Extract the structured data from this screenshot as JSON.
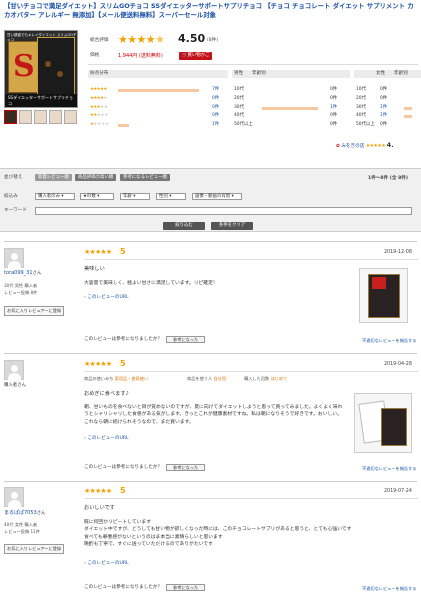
{
  "product": {
    "title": "【甘いチョコで満足ダイエット】スリムGOチョコ SSダイエッターサポートサプリチョコ 【チョコ チョコレート ダイエット サプリメント カカオバター アレルギー 無添加】【メール便送料無料】スーパーセール対象",
    "image_top_caption": "甘い誘惑でもキレイダイエット スリムGOチョコ",
    "image_caption": "SSダイエッターサポートサプリチョコ",
    "image_mark": "S"
  },
  "summary": {
    "rating_label": "総合評価",
    "rating_value": "4.50",
    "rating_count": "(8件)",
    "price_label": "価格",
    "price": "1,944円 (送料無料)",
    "cart_label": "買い物かご",
    "score_dist_label": "採点分布",
    "score_dist": [
      {
        "stars": 5,
        "count": "7件",
        "fraction": 0.88
      },
      {
        "stars": 4,
        "count": "0件",
        "fraction": 0
      },
      {
        "stars": 3,
        "count": "0件",
        "fraction": 0
      },
      {
        "stars": 2,
        "count": "0件",
        "fraction": 0
      },
      {
        "stars": 1,
        "count": "1件",
        "fraction": 0.12
      }
    ],
    "male_label": "男性",
    "female_label": "女性",
    "age_label": "年齢別",
    "male_ages": [
      {
        "age": "10代",
        "count": "0件",
        "fraction": 0
      },
      {
        "age": "20代",
        "count": "0件",
        "fraction": 0
      },
      {
        "age": "30代",
        "count": "1件",
        "fraction": 1
      },
      {
        "age": "40代",
        "count": "0件",
        "fraction": 0
      },
      {
        "age": "50代以上",
        "count": "0件",
        "fraction": 0
      }
    ],
    "female_ages": [
      {
        "age": "10代",
        "count": "0件",
        "fraction": 0
      },
      {
        "age": "20代",
        "count": "0件",
        "fraction": 0
      },
      {
        "age": "30代",
        "count": "1件",
        "fraction": 0.5
      },
      {
        "age": "40代",
        "count": "1件",
        "fraction": 0.5
      },
      {
        "age": "50代以上",
        "count": "0件",
        "fraction": 0
      }
    ],
    "shop_badge_label": "みをぎの店",
    "shop_score": "4."
  },
  "filter": {
    "sort_label": "並び替え",
    "sort_tabs": [
      "新着レビュー順",
      "商品評価が高い順",
      "参考になるレビュー順"
    ],
    "result_count": "1件～8件 (全 8件)",
    "narrow_label": "絞込み",
    "selects": [
      "購入者のみ",
      "★の数",
      "年齢",
      "性別",
      "画像・動画の有無"
    ],
    "keyword_label": "キーワード",
    "narrow_button": "絞り込む",
    "clear_button": "条件をクリア"
  },
  "common": {
    "useful_question": "このレビューは参考になりましたか？",
    "useful_button": "参考になった",
    "report_link": "不適切なレビューを報告する",
    "fav_button": "お気に入りレビュアーに登録",
    "url_link": "このレビューのURL",
    "purchase_count_label": "購入者"
  },
  "reviews": [
    {
      "score": "5",
      "date": "2019-12-08",
      "username": "tora099_31",
      "san": "さん",
      "meta1": "30代 男性 購入者",
      "meta2": "レビュー投稿 8件",
      "title": "美味しい",
      "body": "大容量で美味しく、極よい甘さに満足しています。リピ確定！"
    },
    {
      "score": "5",
      "date": "2019-04-28",
      "username": "購入者",
      "san": "さん",
      "use_label": "商品の使いみち",
      "use_value": "実用品・普段使い",
      "used_label": "商品を使う人",
      "used_value": "自分用",
      "times_label": "購入した回数",
      "times_value": "はじめて",
      "title": "おめぎに食べます♪",
      "body": "朝、甘いものを食べないと目が覚めないのですが、夏に向けてダイエットしようと思って買ってみました。よくよく味わうとシャリシャリした食感がある気がします。きっとこれが健康素材ですね。私は朝になりそうで好きです。おいしい。これなら朝に続けられそうなので、また買います。"
    },
    {
      "score": "5",
      "date": "2019-07-24",
      "username": "まるぱぱ7053",
      "san": "さん",
      "meta1": "40代 女性 購入者",
      "meta2": "レビュー投稿 11件",
      "title": "おいしいです",
      "body": "既に何回かリピートしています\nダイエット中ですが、どうしても甘い物が欲しくなった時には、このチョコレートサプリがあると思うと、とても心強いです\n食べても罪悪感がないというのはま本当に素晴らしいと思います\n晩酌も丁寧で、すぐに送っていただけるのでありがたいです"
    }
  ]
}
